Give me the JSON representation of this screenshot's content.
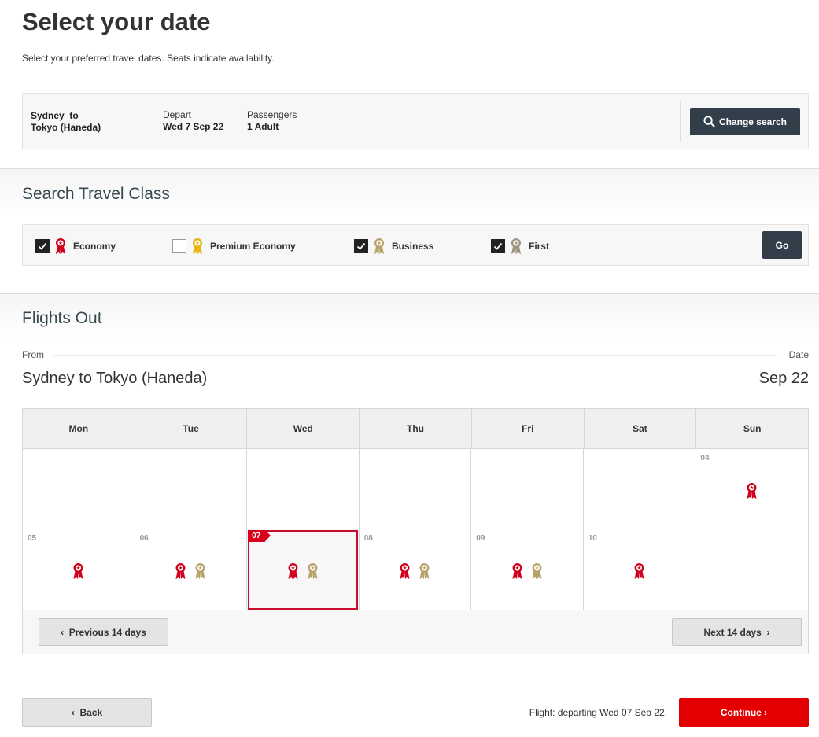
{
  "header": {
    "title": "Select your date",
    "subtitle": "Select your preferred travel dates. Seats indicate availability."
  },
  "summary": {
    "route_from": "Sydney  to",
    "route_to": "Tokyo (Haneda)",
    "depart_label": "Depart",
    "depart_value": "Wed 7 Sep 22",
    "passengers_label": "Passengers",
    "passengers_value": "1 Adult",
    "change_button": "Change search",
    "change_icon": "search-icon"
  },
  "travel_class": {
    "title": "Search Travel Class",
    "options": [
      {
        "label": "Economy",
        "checked": true,
        "color": "#d0021b"
      },
      {
        "label": "Premium Economy",
        "checked": false,
        "color": "#e8b30c"
      },
      {
        "label": "Business",
        "checked": true,
        "color": "#b8a46a"
      },
      {
        "label": "First",
        "checked": true,
        "color": "#9e9482"
      }
    ],
    "go_button": "Go"
  },
  "flights_out": {
    "title": "Flights Out",
    "from_label": "From",
    "date_label": "Date",
    "route": "Sydney to Tokyo (Haneda)",
    "month": "Sep 22"
  },
  "calendar": {
    "weekdays": [
      "Mon",
      "Tue",
      "Wed",
      "Thu",
      "Fri",
      "Sat",
      "Sun"
    ],
    "selected_day": "07",
    "cells": [
      {
        "day": "",
        "awards": []
      },
      {
        "day": "",
        "awards": []
      },
      {
        "day": "",
        "awards": []
      },
      {
        "day": "",
        "awards": []
      },
      {
        "day": "",
        "awards": []
      },
      {
        "day": "",
        "awards": []
      },
      {
        "day": "04",
        "awards": [
          "economy"
        ]
      },
      {
        "day": "05",
        "awards": [
          "economy"
        ]
      },
      {
        "day": "06",
        "awards": [
          "economy",
          "business"
        ]
      },
      {
        "day": "07",
        "awards": [
          "economy",
          "business"
        ]
      },
      {
        "day": "08",
        "awards": [
          "economy",
          "business"
        ]
      },
      {
        "day": "09",
        "awards": [
          "economy",
          "business"
        ]
      },
      {
        "day": "10",
        "awards": [
          "economy"
        ]
      },
      {
        "day": "",
        "awards": []
      }
    ],
    "prev_button": "‹  Previous 14 days",
    "next_button": "Next 14 days  ›"
  },
  "footer": {
    "back_button": "‹  Back",
    "flight_note": "Flight: departing Wed 07 Sep 22.",
    "continue_button": "Continue ›"
  },
  "colors": {
    "economy": "#d0021b",
    "business": "#b8a46a",
    "accent_dark": "#323f4a",
    "continue": "#e40000"
  }
}
